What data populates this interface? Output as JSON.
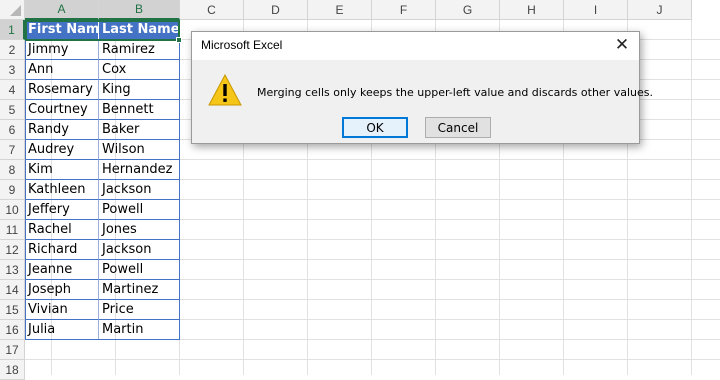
{
  "columns": [
    "A",
    "B",
    "C",
    "D",
    "E",
    "F",
    "G",
    "H",
    "I",
    "J"
  ],
  "rows": [
    "1",
    "2",
    "3",
    "4",
    "5",
    "6",
    "7",
    "8",
    "9",
    "10",
    "11",
    "12",
    "13",
    "14",
    "15",
    "16",
    "17",
    "18"
  ],
  "table": {
    "headers": [
      "First Name",
      "Last Name"
    ],
    "rows": [
      [
        "Jimmy",
        "Ramirez"
      ],
      [
        "Ann",
        "Cox"
      ],
      [
        "Rosemary",
        "King"
      ],
      [
        "Courtney",
        "Bennett"
      ],
      [
        "Randy",
        "Baker"
      ],
      [
        "Audrey",
        "Wilson"
      ],
      [
        "Kim",
        "Hernandez"
      ],
      [
        "Kathleen",
        "Jackson"
      ],
      [
        "Jeffery",
        "Powell"
      ],
      [
        "Rachel",
        "Jones"
      ],
      [
        "Richard",
        "Jackson"
      ],
      [
        "Jeanne",
        "Powell"
      ],
      [
        "Joseph",
        "Martinez"
      ],
      [
        "Vivian",
        "Price"
      ],
      [
        "Julia",
        "Martin"
      ]
    ]
  },
  "dialog": {
    "title": "Microsoft Excel",
    "message": "Merging cells only keeps the upper-left value and discards other values.",
    "ok_label": "OK",
    "cancel_label": "Cancel",
    "icon": "warning-icon",
    "close_icon": "close-icon"
  },
  "colors": {
    "table_header": "#4472c4",
    "selection": "#217346",
    "warning": "#f5c518"
  }
}
